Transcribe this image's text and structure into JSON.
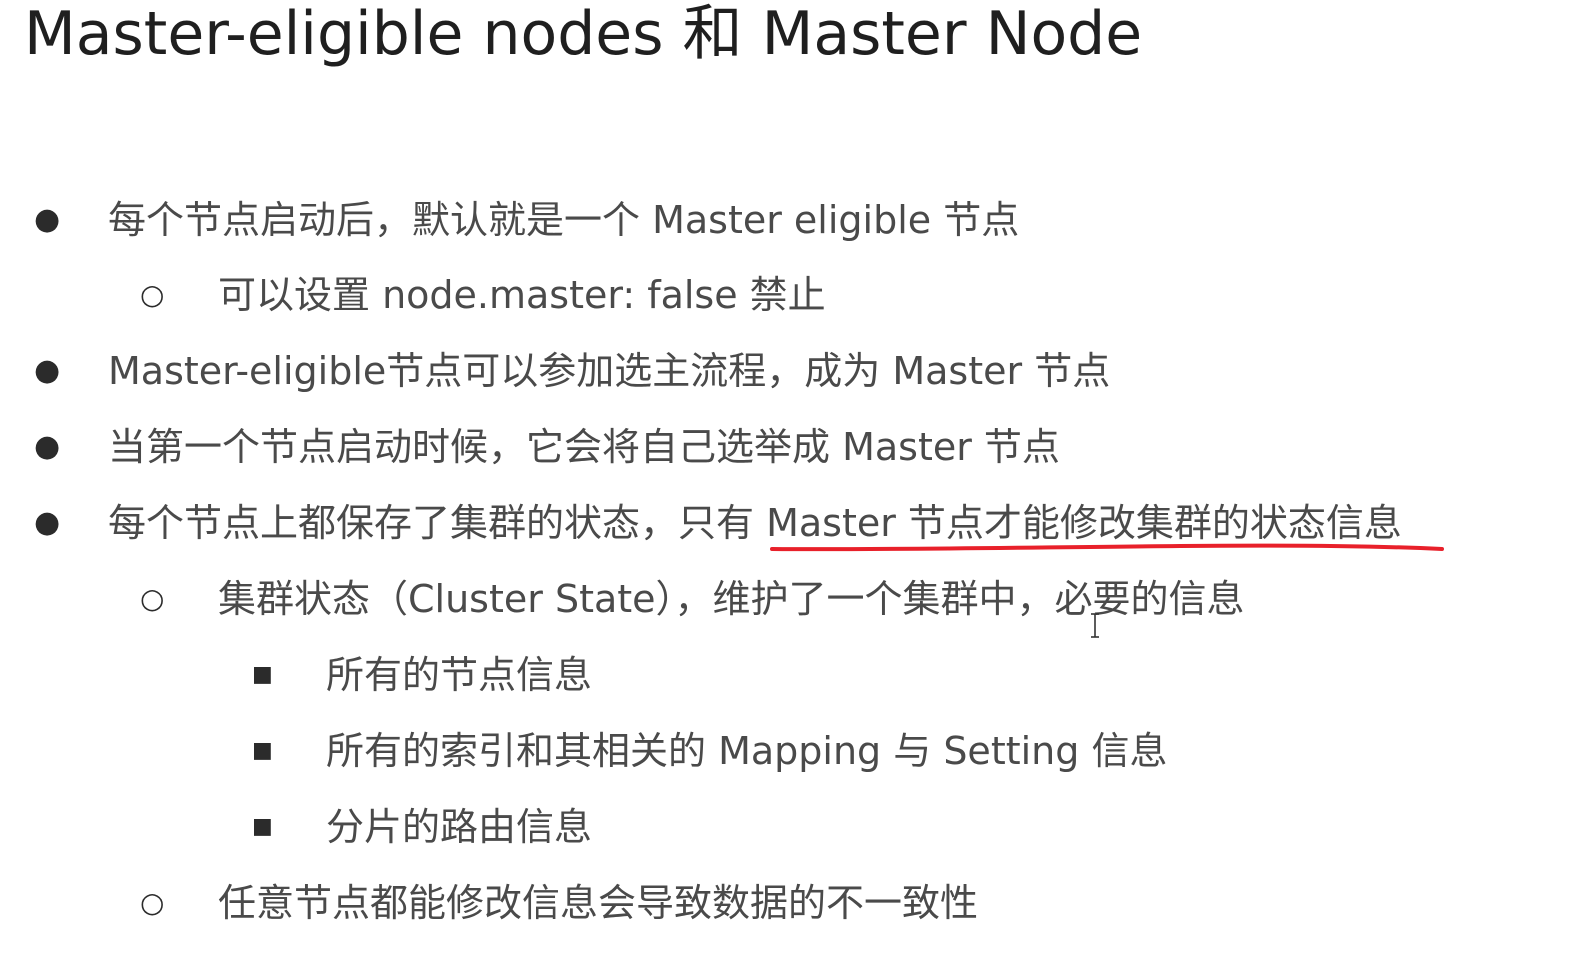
{
  "title": "Master-eligible nodes 和 Master Node",
  "bullets": [
    {
      "level": 1,
      "marker": "●",
      "text": "每个节点启动后，默认就是一个 Master eligible 节点"
    },
    {
      "level": 2,
      "marker": "○",
      "text": "可以设置 node.master: false 禁止"
    },
    {
      "level": 1,
      "marker": "●",
      "text": "Master-eligible节点可以参加选主流程，成为 Master 节点"
    },
    {
      "level": 1,
      "marker": "●",
      "text": "当第一个节点启动时候，它会将自己选举成 Master 节点"
    },
    {
      "level": 1,
      "marker": "●",
      "text": "每个节点上都保存了集群的状态，只有 Master 节点才能修改集群的状态信息"
    },
    {
      "level": 2,
      "marker": "○",
      "text": "集群状态（Cluster State），维护了一个集群中，必要的信息"
    },
    {
      "level": 3,
      "marker": "■",
      "text": "所有的节点信息"
    },
    {
      "level": 3,
      "marker": "■",
      "text": "所有的索引和其相关的 Mapping 与 Setting 信息"
    },
    {
      "level": 3,
      "marker": "■",
      "text": "分片的路由信息"
    },
    {
      "level": 2,
      "marker": "○",
      "text": "任意节点都能修改信息会导致数据的不一致性"
    }
  ],
  "colors": {
    "underline": "#e8202a",
    "text": "#4a4a4a",
    "title": "#1f1f1f"
  },
  "icons": {
    "cursor": "text-cursor-icon"
  }
}
